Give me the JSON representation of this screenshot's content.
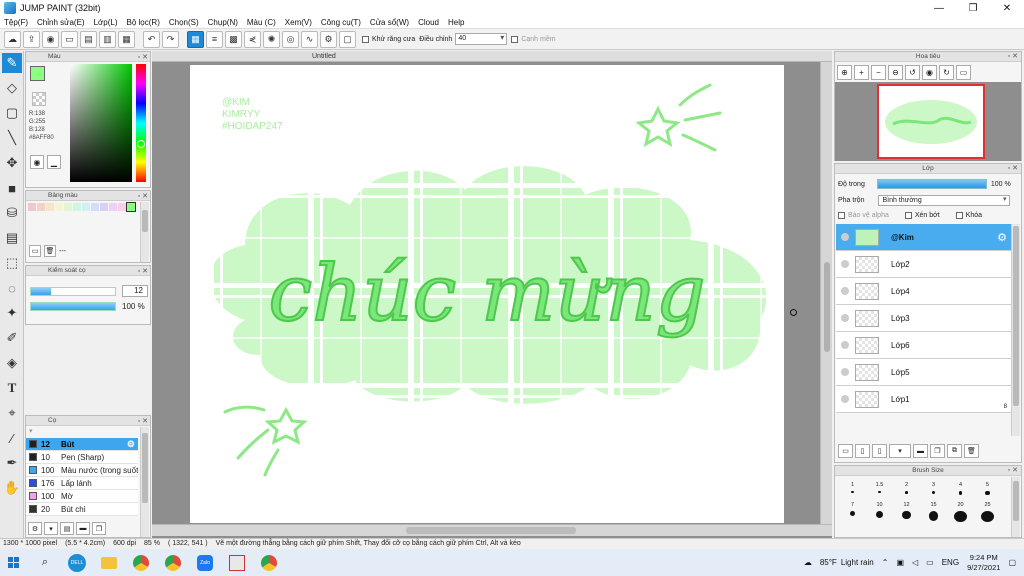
{
  "window": {
    "title": "JUMP PAINT (32bit)",
    "min": "—",
    "max": "❐",
    "close": "✕"
  },
  "menu": [
    "Tệp(F)",
    "Chỉnh sửa(E)",
    "Lớp(L)",
    "Bộ lọc(R)",
    "Chọn(S)",
    "Chụp(N)",
    "Màu (C)",
    "Xem(V)",
    "Công cụ(T)",
    "Cửa sổ(W)",
    "Cloud",
    "Help"
  ],
  "toolbar": {
    "antialias_label": "Khử răng cưa",
    "correction_label": "Điều chỉnh",
    "correction_value": "40",
    "edge_label": "Cạnh mềm"
  },
  "color_panel": {
    "title": "Màu",
    "fg_color": "#8AFF80",
    "r": "R:138",
    "g": "G:255",
    "b": "B:128",
    "hex": "#8AFF80"
  },
  "palette_panel": {
    "title": "Bảng màu",
    "name": "---",
    "swatches": [
      "#f2c7c7",
      "#f5d0c8",
      "#f5e6c8",
      "#f5f5d0",
      "#e0f5d0",
      "#d0f5e0",
      "#d0f0f5",
      "#d0e0f5",
      "#d8d0f5",
      "#eed0f5",
      "#f5d0e8",
      "#8aff80"
    ]
  },
  "brush_size_panel": {
    "title": "Kiểm soát cọ",
    "size": "12",
    "opacity": "100 %"
  },
  "brush_panel": {
    "title": "Cọ",
    "items": [
      {
        "num": "12",
        "name": "Bút",
        "color": "#222222"
      },
      {
        "num": "10",
        "name": "Pen (Sharp)",
        "color": "#222222"
      },
      {
        "num": "100",
        "name": "Màu nước (trong suốt)",
        "color": "#3fa6f0"
      },
      {
        "num": "176",
        "name": "Lấp lánh",
        "color": "#2b4fd6"
      },
      {
        "num": "100",
        "name": "Mờ",
        "color": "#f0a0e6"
      },
      {
        "num": "20",
        "name": "Bút chì",
        "color": "#333333"
      }
    ]
  },
  "document": {
    "tab": "Untitled",
    "watermark": [
      "@KIM",
      "KIMRYY",
      "#HOIDAP247"
    ],
    "lettering": "chúc mừng"
  },
  "navigator": {
    "title": "Hoa tiêu"
  },
  "layers": {
    "title": "Lớp",
    "opacity_label": "Độ trong",
    "opacity_value": "100 %",
    "blend_label": "Pha trộn",
    "blend_value": "Bình thường",
    "protect_alpha": "Bảo vệ alpha",
    "clipping": "Xén bớt",
    "lock": "Khóa",
    "items": [
      "@Kim",
      "Lớp2",
      "Lớp4",
      "Lớp3",
      "Lớp6",
      "Lớp5",
      "Lớp1"
    ],
    "lock_badge": "8"
  },
  "brush_size_list": {
    "title": "Brush Size",
    "sizes": [
      "1",
      "1.5",
      "2",
      "3",
      "4",
      "5",
      "7",
      "10",
      "12",
      "15",
      "20",
      "25"
    ]
  },
  "status": {
    "size": "1300 * 1000 pixel",
    "cm": "(5.5 * 4.2cm)",
    "dpi": "600 dpi",
    "zoom": "85 %",
    "coords": "( 1322, 541 )",
    "hint": "Vẽ một đường thẳng bằng cách giữ phím Shift, Thay đổi cỡ cọ bằng cách giữ phím Ctrl, Alt và kéo"
  },
  "taskbar": {
    "weather_temp": "85°F",
    "weather_text": "Light rain",
    "lang": "ENG",
    "time": "9:24 PM",
    "date": "9/27/2021"
  }
}
